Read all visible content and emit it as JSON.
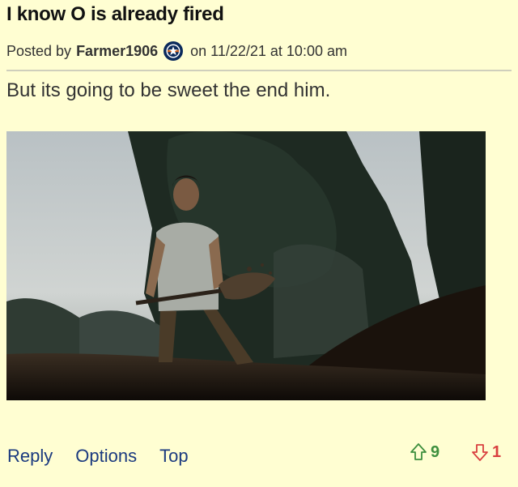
{
  "post": {
    "title": "I know O is already fired",
    "posted_by_label": "Posted by",
    "username": "Farmer1906",
    "on_label": "on",
    "date": "11/22/21",
    "at_label": "at",
    "time": "10:00 am",
    "body": "But its going to be sweet the end him.",
    "badge_icon": "astros-star-icon"
  },
  "actions": {
    "reply": "Reply",
    "options": "Options",
    "top": "Top"
  },
  "votes": {
    "up_count": "9",
    "down_count": "1",
    "up_color": "#3e8f3e",
    "down_color": "#d94040"
  },
  "colors": {
    "background": "#fffed2",
    "link": "#1b3a7f"
  }
}
